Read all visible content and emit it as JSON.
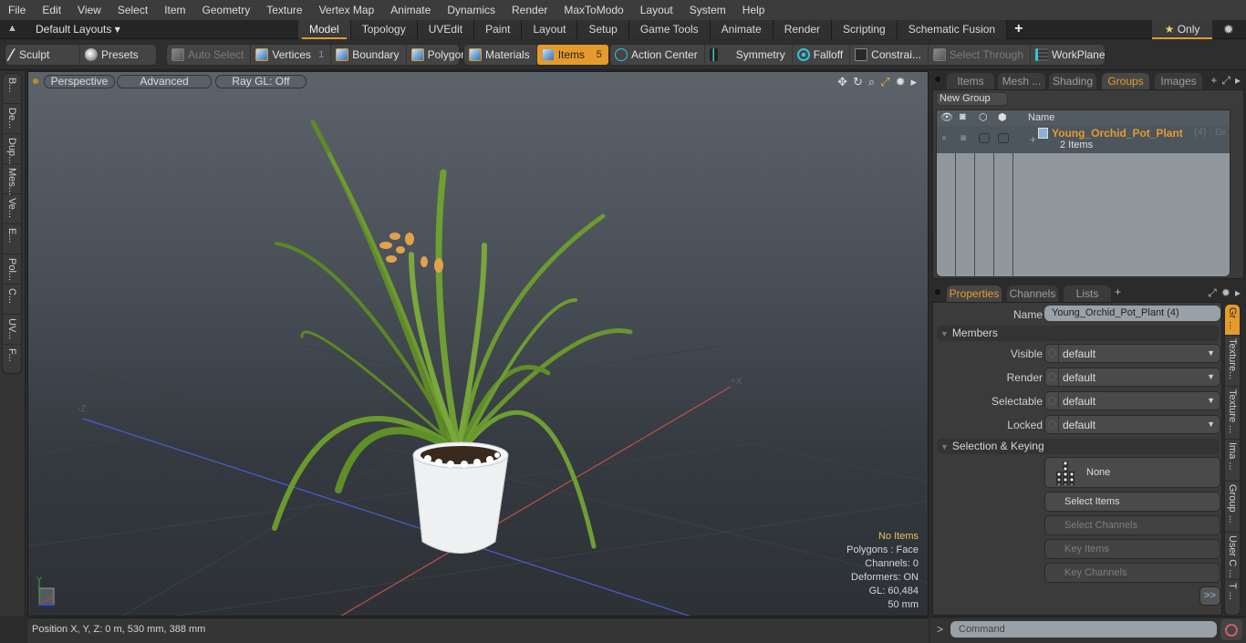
{
  "menubar": {
    "items": [
      "File",
      "Edit",
      "View",
      "Select",
      "Item",
      "Geometry",
      "Texture",
      "Vertex Map",
      "Animate",
      "Dynamics",
      "Render",
      "MaxToModo",
      "Layout",
      "System",
      "Help"
    ]
  },
  "layoutbar": {
    "layouts_label": "Default Layouts",
    "tabs": [
      "Model",
      "Topology",
      "UVEdit",
      "Paint",
      "Layout",
      "Setup",
      "Game Tools",
      "Animate",
      "Render",
      "Scripting",
      "Schematic Fusion"
    ],
    "active_tab": "Model",
    "add_tab": "+",
    "only_label": "Only"
  },
  "toolbar": {
    "sculpt": "Sculpt",
    "presets": "Presets",
    "auto_select": "Auto Select",
    "vertices": "Vertices",
    "vertices_count": "1",
    "boundary": "Boundary",
    "polygons": "Polygons",
    "materials": "Materials",
    "items": "Items",
    "items_count": "5",
    "action_center": "Action Center",
    "symmetry": "Symmetry",
    "falloff": "Falloff",
    "constraints": "Constrai...",
    "select_through": "Select Through",
    "workplane": "WorkPlane"
  },
  "left_tabs": [
    "B...",
    "De...",
    "Dup...",
    "Mes...",
    "Ve...",
    "E...",
    "Pol...",
    "C...",
    "UV...",
    "F..."
  ],
  "viewport": {
    "view_mode": "Perspective",
    "shading": "Advanced",
    "raygl": "Ray GL: Off",
    "axis_minus_z": "-Z",
    "axis_plus_x": "+X",
    "gizmo_y": "Y",
    "info": {
      "selection": "No Items",
      "polygons": "Polygons : Face",
      "channels": "Channels: 0",
      "deformers": "Deformers: ON",
      "gl": "GL: 60,484",
      "scale": "50 mm"
    }
  },
  "statusbar": {
    "position": "Position X, Y, Z:   0 m, 530 mm, 388 mm"
  },
  "groups_panel": {
    "tabs": [
      "Items",
      "Mesh ...",
      "Shading",
      "Groups",
      "Images"
    ],
    "active_tab": "Groups",
    "new_group": "New Group",
    "column_name": "Name",
    "rows": [
      {
        "name": "Young_Orchid_Pot_Plant",
        "count": "(4)",
        "type": ": Gr ...",
        "sub": "2 Items"
      }
    ]
  },
  "properties_panel": {
    "tabs": [
      "Properties",
      "Channels",
      "Lists"
    ],
    "active_tab": "Properties",
    "name_label": "Name",
    "name_value": "Young_Orchid_Pot_Plant (4)",
    "members_section": "Members",
    "fields": [
      {
        "label": "Visible",
        "value": "default"
      },
      {
        "label": "Render",
        "value": "default"
      },
      {
        "label": "Selectable",
        "value": "default"
      },
      {
        "label": "Locked",
        "value": "default"
      }
    ],
    "selection_section": "Selection & Keying",
    "none_button": "None",
    "select_items": "Select Items",
    "select_channels": "Select Channels",
    "key_items": "Key Items",
    "key_channels": "Key Channels",
    "more": ">>",
    "side_tabs": [
      "Gr ...",
      "Texture...",
      "Texture ...",
      "Ima ...",
      "Group ...",
      "User C ...",
      "T ..."
    ]
  },
  "command": {
    "prompt": ">",
    "placeholder": "Command"
  },
  "colors": {
    "accent": "#e59b2c",
    "cyan": "#35c4d6",
    "info_highlight": "#eac35a"
  }
}
